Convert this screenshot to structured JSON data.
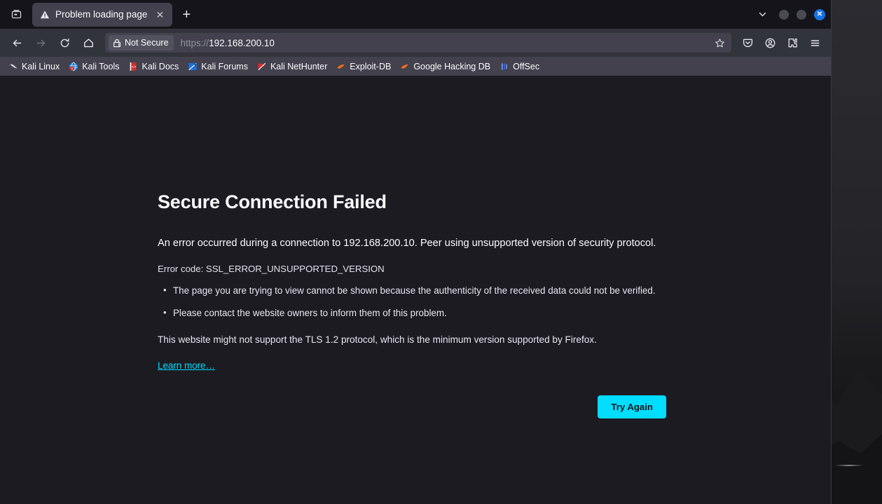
{
  "window": {
    "controls": {
      "chevron": "chevron-down",
      "minimize": "minimize",
      "maximize": "maximize",
      "close": "✕"
    }
  },
  "tabstrip": {
    "firefox_view_icon": "firefox-view-icon",
    "tab": {
      "title": "Problem loading page",
      "favicon": "warning-triangle-icon",
      "close_label": "✕"
    },
    "new_tab_label": "+"
  },
  "navbar": {
    "back_icon": "←",
    "forward_icon": "→",
    "reload_icon": "reload-icon",
    "home_icon": "home-icon",
    "security": {
      "label": "Not Secure",
      "icon": "lock-warning-icon"
    },
    "url": {
      "scheme": "https://",
      "host": "192.168.200.10",
      "full": "https://192.168.200.10"
    },
    "bookmark_star_icon": "star-icon",
    "right_icons": [
      {
        "name": "pocket-icon"
      },
      {
        "name": "account-icon"
      },
      {
        "name": "extensions-icon"
      },
      {
        "name": "app-menu-icon"
      }
    ]
  },
  "bookmarks": [
    {
      "label": "Kali Linux",
      "icon": "kali-dragon-icon",
      "color": "#e8e8ea"
    },
    {
      "label": "Kali Tools",
      "icon": "kali-tools-icon",
      "color": "#2b7fd4"
    },
    {
      "label": "Kali Docs",
      "icon": "kali-docs-icon",
      "color": "#d42b2b"
    },
    {
      "label": "Kali Forums",
      "icon": "kali-forums-icon",
      "color": "#1a6fd4"
    },
    {
      "label": "Kali NetHunter",
      "icon": "kali-nethunter-icon",
      "color": "#d42b2b"
    },
    {
      "label": "Exploit-DB",
      "icon": "exploit-db-icon",
      "color": "#f06a1e"
    },
    {
      "label": "Google Hacking DB",
      "icon": "google-hacking-db-icon",
      "color": "#f06a1e"
    },
    {
      "label": "OffSec",
      "icon": "offsec-icon",
      "color": "#5a7fd4"
    }
  ],
  "error_page": {
    "title": "Secure Connection Failed",
    "short_description": "An error occurred during a connection to 192.168.200.10. Peer using unsupported version of security protocol.",
    "error_code_text": "Error code: SSL_ERROR_UNSUPPORTED_VERSION",
    "bullets": [
      "The page you are trying to view cannot be shown because the authenticity of the received data could not be verified.",
      "Please contact the website owners to inform them of this problem."
    ],
    "tls_note": "This website might not support the TLS 1.2 protocol, which is the minimum version supported by Firefox.",
    "learn_more_label": "Learn more…",
    "try_again_label": "Try Again",
    "accent_color": "#00ddff"
  }
}
